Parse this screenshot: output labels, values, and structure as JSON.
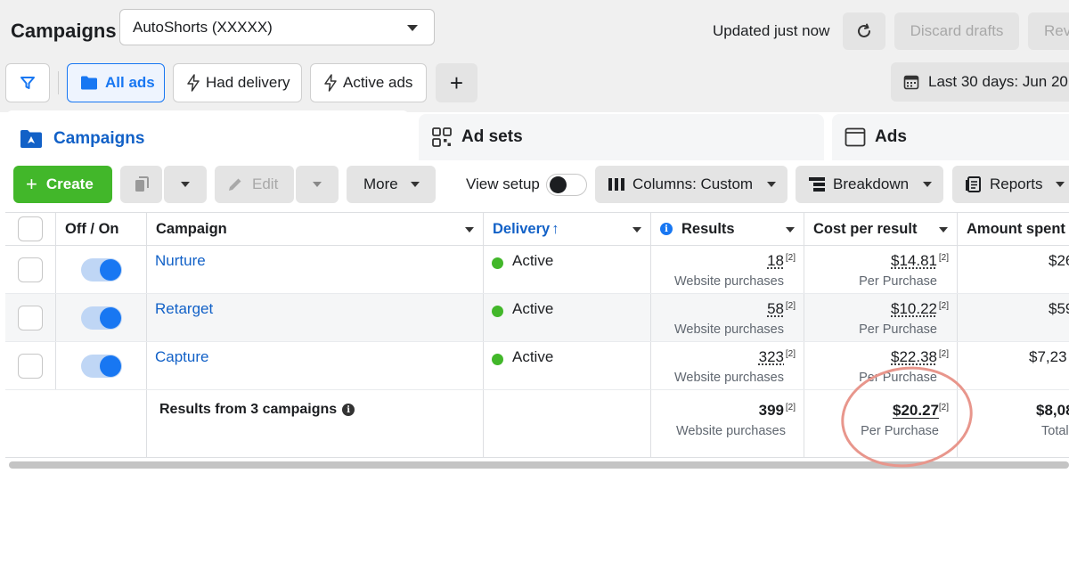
{
  "header": {
    "title": "Campaigns",
    "account": "AutoShorts (XXXXX)",
    "updated": "Updated just now",
    "discard": "Discard drafts",
    "review": "Rev"
  },
  "filters": {
    "all_ads": "All ads",
    "had_delivery": "Had delivery",
    "active_ads": "Active ads",
    "add": "+",
    "date_range": "Last 30 days: Jun 20,"
  },
  "tabs": {
    "campaigns": "Campaigns",
    "adsets": "Ad sets",
    "ads": "Ads"
  },
  "toolbar": {
    "create": "Create",
    "edit": "Edit",
    "more": "More",
    "view_setup": "View setup",
    "columns": "Columns: Custom",
    "breakdown": "Breakdown",
    "reports": "Reports"
  },
  "table": {
    "headers": {
      "onoff": "Off / On",
      "campaign": "Campaign",
      "delivery": "Delivery",
      "results": "Results",
      "cpr": "Cost per result",
      "amount": "Amount spent"
    },
    "rows": [
      {
        "name": "Nurture",
        "delivery": "Active",
        "results": "18",
        "results_ref": "[2]",
        "results_sub": "Website purchases",
        "cpr": "$14.81",
        "cpr_ref": "[2]",
        "cpr_sub": "Per Purchase",
        "amount": "$26"
      },
      {
        "name": "Retarget",
        "delivery": "Active",
        "results": "58",
        "results_ref": "[2]",
        "results_sub": "Website purchases",
        "cpr": "$10.22",
        "cpr_ref": "[2]",
        "cpr_sub": "Per Purchase",
        "amount": "$59"
      },
      {
        "name": "Capture",
        "delivery": "Active",
        "results": "323",
        "results_ref": "[2]",
        "results_sub": "Website purchases",
        "cpr": "$22.38",
        "cpr_ref": "[2]",
        "cpr_sub": "Per Purchase",
        "amount": "$7,23"
      }
    ],
    "summary": {
      "label": "Results from 3 campaigns",
      "results": "399",
      "results_ref": "[2]",
      "results_sub": "Website purchases",
      "cpr": "$20.27",
      "cpr_ref": "[2]",
      "cpr_sub": "Per Purchase",
      "amount": "$8,08",
      "amount_sub": "Total"
    }
  },
  "colors": {
    "brand_blue": "#1877f2",
    "create_green": "#42b72a",
    "active_green": "#42b72a",
    "annotation": "#e8968c"
  }
}
